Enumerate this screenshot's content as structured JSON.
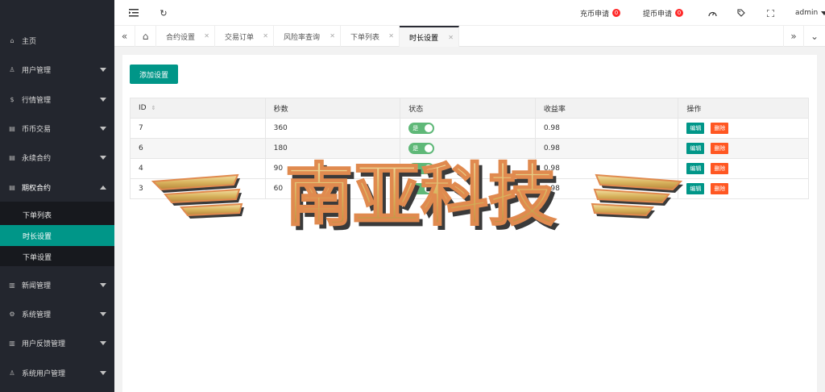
{
  "sidebar": {
    "items": [
      {
        "label": "主页",
        "icon": "home-icon"
      },
      {
        "label": "用户管理",
        "icon": "user-icon"
      },
      {
        "label": "行情管理",
        "icon": "dollar-icon"
      },
      {
        "label": "币币交易",
        "icon": "doc-icon"
      },
      {
        "label": "永续合约",
        "icon": "doc-icon"
      },
      {
        "label": "期权合约",
        "icon": "doc-icon"
      },
      {
        "label": "新闻管理",
        "icon": "news-icon"
      },
      {
        "label": "系统管理",
        "icon": "gear-icon"
      },
      {
        "label": "用户反馈管理",
        "icon": "news-icon"
      },
      {
        "label": "系统用户管理",
        "icon": "user-icon"
      }
    ],
    "sub_items": [
      {
        "label": "下单列表"
      },
      {
        "label": "时长设置"
      },
      {
        "label": "下单设置"
      }
    ]
  },
  "topbar": {
    "recharge_label": "充币申请",
    "recharge_count": "0",
    "withdraw_label": "提币申请",
    "withdraw_count": "0",
    "user": "admin"
  },
  "tabs": [
    {
      "label": "合约设置"
    },
    {
      "label": "交易订单"
    },
    {
      "label": "风险率查询"
    },
    {
      "label": "下单列表"
    },
    {
      "label": "时长设置"
    }
  ],
  "main": {
    "add_button": "添加设置",
    "columns": [
      "ID",
      "秒数",
      "状态",
      "收益率",
      "操作"
    ],
    "rows": [
      {
        "id": "7",
        "seconds": "360",
        "status": "是",
        "rate": "0.98"
      },
      {
        "id": "6",
        "seconds": "180",
        "status": "是",
        "rate": "0.98"
      },
      {
        "id": "4",
        "seconds": "90",
        "status": "是",
        "rate": "0.98"
      },
      {
        "id": "3",
        "seconds": "60",
        "status": "是",
        "rate": "0.98"
      }
    ],
    "edit_label": "编辑",
    "delete_label": "删除"
  },
  "watermark": {
    "text": "南亚科技"
  },
  "colors": {
    "accent": "#009688",
    "sidebar": "#23262e",
    "danger": "#ff5722",
    "switch_on": "#5fb878",
    "badge": "#ff2a2a"
  }
}
